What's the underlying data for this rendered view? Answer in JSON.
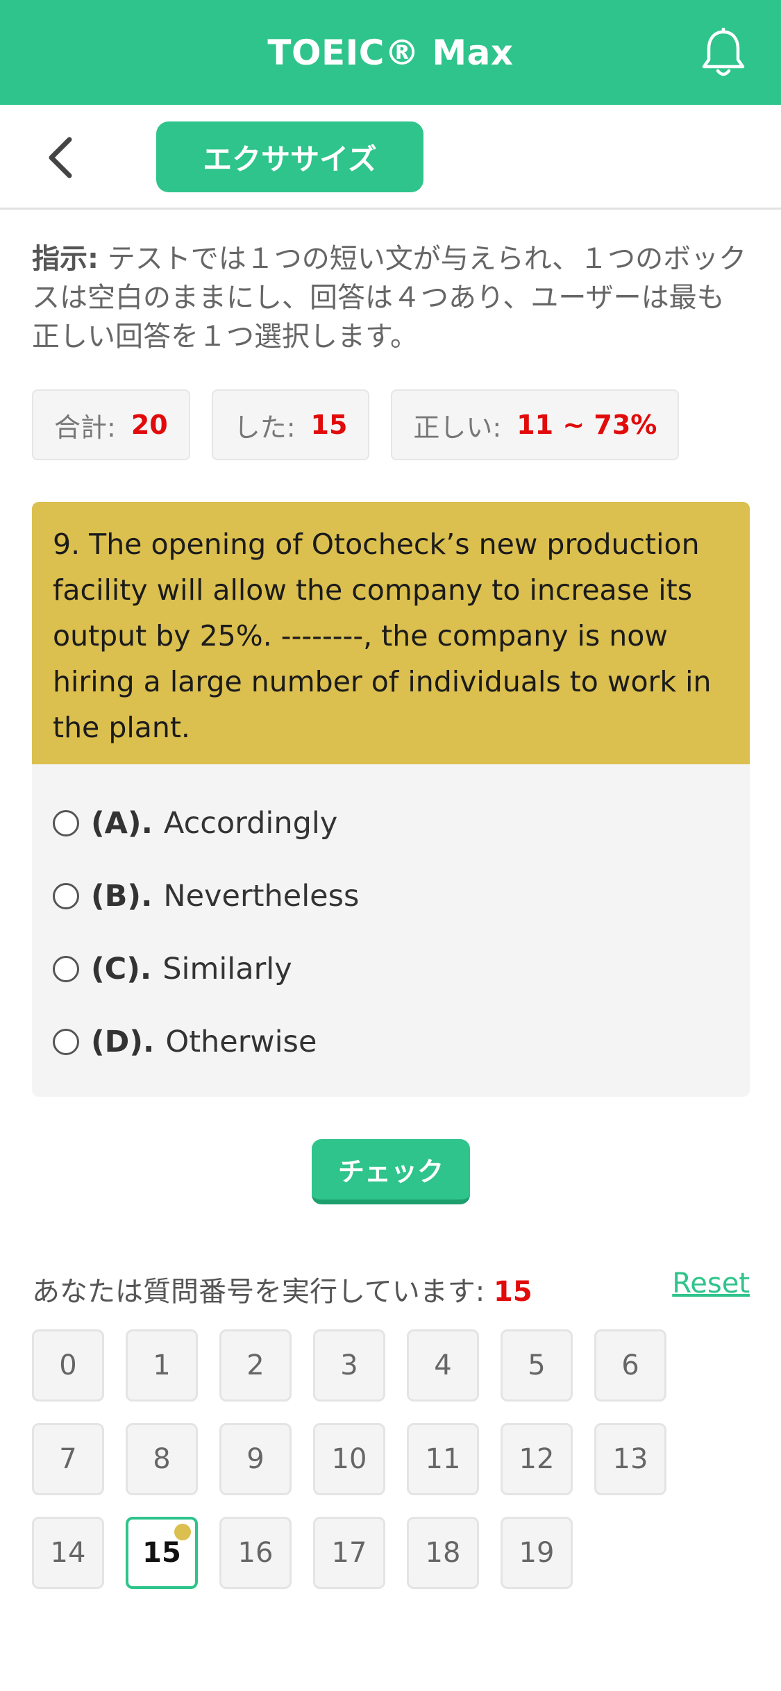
{
  "header": {
    "title": "TOEIC® Max",
    "icon": "bell-icon"
  },
  "subbar": {
    "back_icon": "back-chevron-icon",
    "tab_label": "エクササイズ"
  },
  "instructions": {
    "label": "指示:",
    "text": " テストでは１つの短い文が与えられ、１つのボックスは空白のままにし、回答は４つあり、ユーザーは最も正しい回答を１つ選択します。"
  },
  "stats": {
    "total_label": "合計:",
    "total_value": "20",
    "done_label": "した:",
    "done_value": "15",
    "correct_label": "正しい:",
    "correct_value": "11 ~ 73%"
  },
  "question": {
    "text": "9. The opening of Otocheck’s new production facility will allow the company to increase its output by 25%. --------, the company is now hiring a large number of individuals to work in the plant.",
    "options": [
      {
        "label": "(A).",
        "text": "Accordingly"
      },
      {
        "label": "(B).",
        "text": "Nevertheless"
      },
      {
        "label": "(C).",
        "text": "Similarly"
      },
      {
        "label": "(D).",
        "text": "Otherwise"
      }
    ]
  },
  "check_button": {
    "label": "チェック"
  },
  "progress": {
    "label": "あなたは質問番号を実行しています: ",
    "current": "15",
    "reset_label": "Reset"
  },
  "question_numbers": [
    "0",
    "1",
    "2",
    "3",
    "4",
    "5",
    "6",
    "7",
    "8",
    "9",
    "10",
    "11",
    "12",
    "13",
    "14",
    "15",
    "16",
    "17",
    "18",
    "19"
  ],
  "colors": {
    "accent": "#2ec48b",
    "question_bg": "#dbbf4f",
    "highlight_number": "#e10b0b"
  }
}
